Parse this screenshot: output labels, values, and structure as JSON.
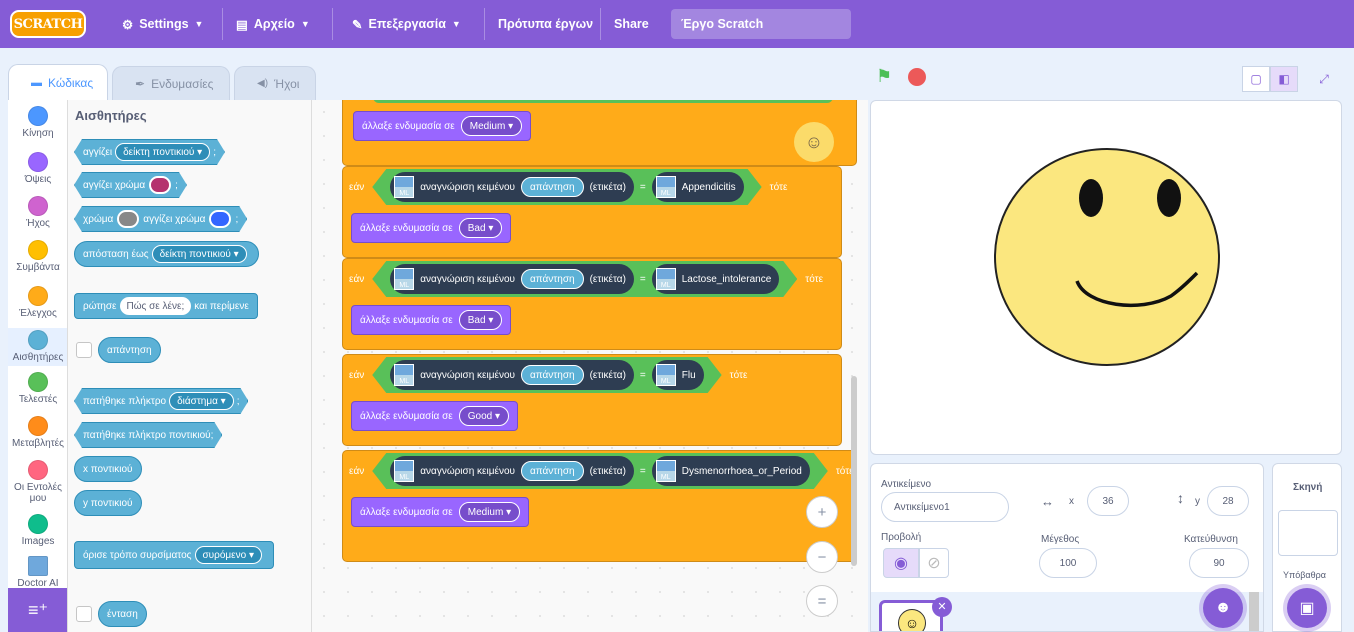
{
  "menubar": {
    "logo": "SCRATCH",
    "settings": "Settings",
    "file": "Αρχείο",
    "edit": "Επεξεργασία",
    "tutorials": "Πρότυπα έργων",
    "share": "Share",
    "project_title": "Έργο Scratch"
  },
  "tabs": {
    "code": "Κώδικας",
    "costumes": "Ενδυμασίες",
    "sounds": "Ήχοι"
  },
  "categories": [
    {
      "label": "Κίνηση",
      "color": "#4c97ff"
    },
    {
      "label": "Όψεις",
      "color": "#9966ff"
    },
    {
      "label": "Ήχος",
      "color": "#cf63cf"
    },
    {
      "label": "Συμβάντα",
      "color": "#ffbf00"
    },
    {
      "label": "Έλεγχος",
      "color": "#ffab19"
    },
    {
      "label": "Αισθητήρες",
      "color": "#5cb1d6"
    },
    {
      "label": "Τελεστές",
      "color": "#59c059"
    },
    {
      "label": "Μεταβλητές",
      "color": "#ff8c1a"
    },
    {
      "label": "Οι Εντολές μου",
      "color": "#ff6680"
    },
    {
      "label": "Images",
      "color": "#0fbd8c"
    },
    {
      "label": "Doctor AI",
      "color": "#6fa8dc"
    }
  ],
  "palette": {
    "title": "Αισθητήρες",
    "touching": "αγγίζει",
    "touching_menu": "δείκτη ποντικιού",
    "touching_color": "αγγίζει χρώμα",
    "color_word": "χρώμα",
    "color_touching": "αγγίζει χρώμα",
    "distance": "απόσταση έως",
    "distance_menu": "δείκτη ποντικιού",
    "ask": "ρώτησε",
    "ask_default": "Πώς σε λένε;",
    "ask_wait": "και περίμενε",
    "answer": "απάντηση",
    "keypressed": "πατήθηκε πλήκτρο",
    "key_menu": "διάστημα",
    "mousedown": "πατήθηκε πλήκτρο ποντικιού;",
    "mousex": "x ποντικιού",
    "mousey": "y ποντικιού",
    "dragmode": "όρισε τρόπο συρσίματος",
    "drag_menu": "συρόμενο",
    "loudness": "ένταση",
    "colors": {
      "swatch1": "#b5336e",
      "swatch2": "#888888",
      "swatch3": "#3366ff"
    }
  },
  "script": {
    "if_word": "εάν",
    "then_word": "τότε",
    "recognize": "αναγνώριση κειμένου",
    "answer": "απάντηση",
    "label_word": "(ετικέτα)",
    "eq": "=",
    "ml_icon_text": "ML",
    "switch_costume": "άλλαξε ενδυμασία σε",
    "top_costume": "Medium",
    "blocks": [
      {
        "label": "Appendicitis",
        "costume": "Bad"
      },
      {
        "label": "Lactose_intolerance",
        "costume": "Bad"
      },
      {
        "label": "Flu",
        "costume": "Good"
      },
      {
        "label": "Dysmenorrhoea_or_Period",
        "costume": "Medium"
      }
    ]
  },
  "zoom": {
    "in": "+",
    "out": "−",
    "reset": "="
  },
  "sprite_info": {
    "object_label": "Αντικείμενο",
    "object_name": "Αντικείμενο1",
    "x_label": "x",
    "x_value": "36",
    "y_label": "y",
    "y_value": "28",
    "show_label": "Προβολή",
    "size_label": "Μέγεθος",
    "size_value": "100",
    "direction_label": "Κατεύθυνση",
    "direction_value": "90"
  },
  "stage_pane": {
    "title": "Σκηνή",
    "backdrops_label": "Υπόβαθρα"
  }
}
